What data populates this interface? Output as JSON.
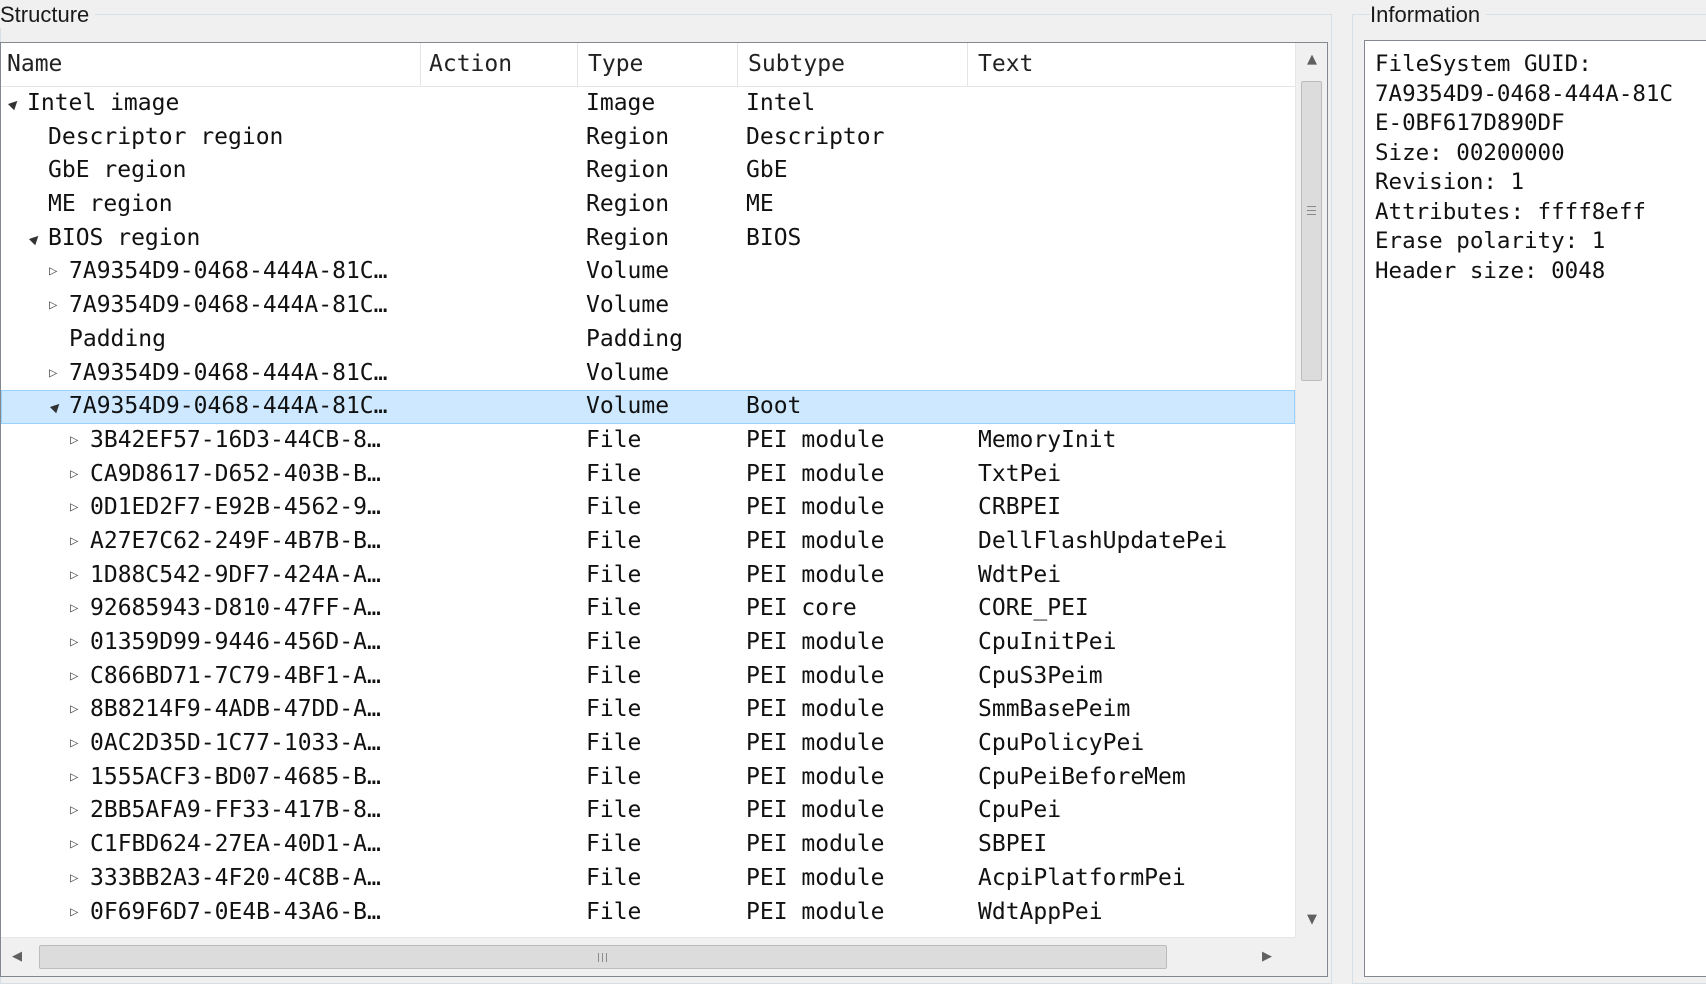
{
  "structure": {
    "title": "Structure",
    "columns": [
      "Name",
      "Action",
      "Type",
      "Subtype",
      "Text"
    ],
    "rows": [
      {
        "name": "Intel image",
        "action": "",
        "type": "Image",
        "subtype": "Intel",
        "text": "",
        "expander": "open"
      },
      {
        "name": "Descriptor region",
        "action": "",
        "type": "Region",
        "subtype": "Descriptor",
        "text": "",
        "expander": "none"
      },
      {
        "name": "GbE region",
        "action": "",
        "type": "Region",
        "subtype": "GbE",
        "text": "",
        "expander": "none"
      },
      {
        "name": "ME region",
        "action": "",
        "type": "Region",
        "subtype": "ME",
        "text": "",
        "expander": "none"
      },
      {
        "name": "BIOS region",
        "action": "",
        "type": "Region",
        "subtype": "BIOS",
        "text": "",
        "expander": "open"
      },
      {
        "name": "7A9354D9-0468-444A-81C…",
        "action": "",
        "type": "Volume",
        "subtype": "",
        "text": "",
        "expander": "closed"
      },
      {
        "name": "7A9354D9-0468-444A-81C…",
        "action": "",
        "type": "Volume",
        "subtype": "",
        "text": "",
        "expander": "closed"
      },
      {
        "name": "Padding",
        "action": "",
        "type": "Padding",
        "subtype": "",
        "text": "",
        "expander": "none"
      },
      {
        "name": "7A9354D9-0468-444A-81C…",
        "action": "",
        "type": "Volume",
        "subtype": "",
        "text": "",
        "expander": "closed"
      },
      {
        "name": "7A9354D9-0468-444A-81C…",
        "action": "",
        "type": "Volume",
        "subtype": "Boot",
        "text": "",
        "expander": "open",
        "selected": true
      },
      {
        "name": "3B42EF57-16D3-44CB-8…",
        "action": "",
        "type": "File",
        "subtype": "PEI module",
        "text": "MemoryInit",
        "expander": "closed"
      },
      {
        "name": "CA9D8617-D652-403B-B…",
        "action": "",
        "type": "File",
        "subtype": "PEI module",
        "text": "TxtPei",
        "expander": "closed"
      },
      {
        "name": "0D1ED2F7-E92B-4562-9…",
        "action": "",
        "type": "File",
        "subtype": "PEI module",
        "text": "CRBPEI",
        "expander": "closed"
      },
      {
        "name": "A27E7C62-249F-4B7B-B…",
        "action": "",
        "type": "File",
        "subtype": "PEI module",
        "text": "DellFlashUpdatePei",
        "expander": "closed"
      },
      {
        "name": "1D88C542-9DF7-424A-A…",
        "action": "",
        "type": "File",
        "subtype": "PEI module",
        "text": "WdtPei",
        "expander": "closed"
      },
      {
        "name": "92685943-D810-47FF-A…",
        "action": "",
        "type": "File",
        "subtype": "PEI core",
        "text": "CORE_PEI",
        "expander": "closed"
      },
      {
        "name": "01359D99-9446-456D-A…",
        "action": "",
        "type": "File",
        "subtype": "PEI module",
        "text": "CpuInitPei",
        "expander": "closed"
      },
      {
        "name": "C866BD71-7C79-4BF1-A…",
        "action": "",
        "type": "File",
        "subtype": "PEI module",
        "text": "CpuS3Peim",
        "expander": "closed"
      },
      {
        "name": "8B8214F9-4ADB-47DD-A…",
        "action": "",
        "type": "File",
        "subtype": "PEI module",
        "text": "SmmBasePeim",
        "expander": "closed"
      },
      {
        "name": "0AC2D35D-1C77-1033-A…",
        "action": "",
        "type": "File",
        "subtype": "PEI module",
        "text": "CpuPolicyPei",
        "expander": "closed"
      },
      {
        "name": "1555ACF3-BD07-4685-B…",
        "action": "",
        "type": "File",
        "subtype": "PEI module",
        "text": "CpuPeiBeforeMem",
        "expander": "closed"
      },
      {
        "name": "2BB5AFA9-FF33-417B-8…",
        "action": "",
        "type": "File",
        "subtype": "PEI module",
        "text": "CpuPei",
        "expander": "closed"
      },
      {
        "name": "C1FBD624-27EA-40D1-A…",
        "action": "",
        "type": "File",
        "subtype": "PEI module",
        "text": "SBPEI",
        "expander": "closed"
      },
      {
        "name": "333BB2A3-4F20-4C8B-A…",
        "action": "",
        "type": "File",
        "subtype": "PEI module",
        "text": "AcpiPlatformPei",
        "expander": "closed"
      },
      {
        "name": "0F69F6D7-0E4B-43A6-B…",
        "action": "",
        "type": "File",
        "subtype": "PEI module",
        "text": "WdtAppPei",
        "expander": "closed"
      }
    ]
  },
  "information": {
    "title": "Information",
    "lines": [
      "FileSystem GUID:",
      "7A9354D9-0468-444A-81C",
      "E-0BF617D890DF",
      "Size: 00200000",
      "Revision: 1",
      "Attributes: ffff8eff",
      "Erase polarity: 1",
      "Header size: 0048"
    ]
  },
  "icons": {
    "expanded": "▲",
    "collapsed": "▷",
    "scroll_up": "▲",
    "scroll_down": "▼",
    "scroll_left": "◀",
    "scroll_right": "▶"
  },
  "colors": {
    "selection_fill": "#cde8ff",
    "selection_border": "#99d1ff"
  }
}
